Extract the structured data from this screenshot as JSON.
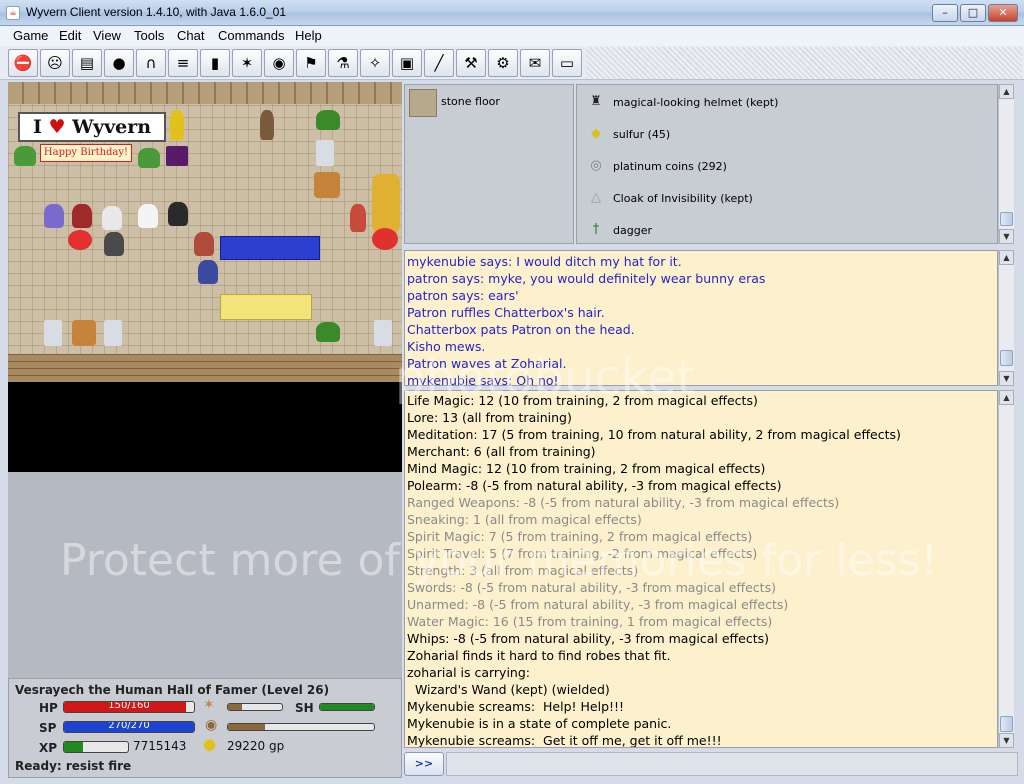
{
  "window": {
    "title": "Wyvern Client version 1.4.10, with Java 1.6.0_01",
    "min_glyph": "–",
    "max_glyph": "□",
    "close_glyph": "✕"
  },
  "menu": [
    "Game",
    "Edit",
    "View",
    "Tools",
    "Chat",
    "Commands",
    "Help"
  ],
  "toolbar": {
    "buttons": [
      {
        "icon": "no-entry-icon",
        "glyph": "⛔"
      },
      {
        "icon": "who-icon",
        "glyph": "☹"
      },
      {
        "icon": "bag-icon",
        "glyph": "▤"
      },
      {
        "icon": "coins-icon",
        "glyph": "●"
      },
      {
        "icon": "doorway-icon",
        "glyph": "∩"
      },
      {
        "icon": "scroll-icon",
        "glyph": "≡"
      },
      {
        "icon": "door-icon",
        "glyph": "▮"
      },
      {
        "icon": "cast-icon",
        "glyph": "✶"
      },
      {
        "icon": "eye-icon",
        "glyph": "◉"
      },
      {
        "icon": "signpost-icon",
        "glyph": "⚑"
      },
      {
        "icon": "potion-icon",
        "glyph": "⚗"
      },
      {
        "icon": "sparkle-icon",
        "glyph": "✧"
      },
      {
        "icon": "lock-icon",
        "glyph": "▣"
      },
      {
        "icon": "wand-icon",
        "glyph": "╱"
      },
      {
        "icon": "tools-icon",
        "glyph": "⚒"
      },
      {
        "icon": "gear-icon",
        "glyph": "⚙"
      },
      {
        "icon": "speech-bubble-icon",
        "glyph": "✉"
      },
      {
        "icon": "chat-bubble-icon",
        "glyph": "▭"
      }
    ]
  },
  "map": {
    "banner_pre": "I",
    "banner_heart": "♥",
    "banner_post": "Wyvern",
    "sign": "Happy Birthday!"
  },
  "floor": {
    "label": "stone floor"
  },
  "inventory": [
    {
      "label": "magical-looking helmet (kept)",
      "icon": "helmet-icon",
      "glyph": "♜",
      "color": "#222222"
    },
    {
      "label": "sulfur (45)",
      "icon": "sulfur-icon",
      "glyph": "◆",
      "color": "#d8c21a"
    },
    {
      "label": "platinum coins (292)",
      "icon": "coins-icon",
      "glyph": "◎",
      "color": "#7a7f88"
    },
    {
      "label": "Cloak of Invisibility (kept)",
      "icon": "cloak-icon",
      "glyph": "△",
      "color": "#9aa0a8"
    },
    {
      "label": "dagger",
      "icon": "dagger-icon",
      "glyph": "†",
      "color": "#3a7a2a"
    }
  ],
  "chat": [
    "mykenubie says: I would ditch my hat for it.",
    "patron says: myke, you would definitely wear bunny eras",
    "patron says: ears'",
    "Patron ruffles Chatterbox's hair.",
    "Chatterbox pats Patron on the head.",
    "Kisho mews.",
    "Patron waves at Zoharial.",
    "mykenubie says: Oh no!"
  ],
  "log": [
    "Life Magic: 12 (10 from training, 2 from magical effects)",
    "Lore: 13 (all from training)",
    "Meditation: 17 (5 from training, 10 from natural ability, 2 from magical effects)",
    "Merchant: 6 (all from training)",
    "Mind Magic: 12 (10 from training, 2 from magical effects)",
    "Polearm: -8 (-5 from natural ability, -3 from magical effects)",
    "Ranged Weapons: -8 (-5 from natural ability, -3 from magical effects)",
    "Sneaking: 1 (all from magical effects)",
    "Spirit Magic: 7 (5 from training, 2 from magical effects)",
    "Spirit Travel: 5 (7 from training, -2 from magical effects)",
    "Strength: 3 (all from magical effects)",
    "Swords: -8 (-5 from natural ability, -3 from magical effects)",
    "Unarmed: -8 (-5 from natural ability, -3 from magical effects)",
    "Water Magic: 16 (15 from training, 1 from magical effects)",
    "Whips: -8 (-5 from natural ability, -3 from magical effects)",
    "Zoharial finds it hard to find robes that fit.",
    "zoharial is carrying:",
    "  Wizard's Wand (kept) (wielded)",
    "Mykenubie screams:  Help! Help!!!",
    "Mykenubie is in a state of complete panic.",
    "Mykenubie screams:  Get it off me, get it off me!!!"
  ],
  "status": {
    "character": "Vesrayech the Human Hall of Famer (Level 26)",
    "hp_label": "HP",
    "hp_text": "150/160",
    "hp_fraction": 0.94,
    "sp_label": "SP",
    "sp_text": "270/270",
    "sp_fraction": 1.0,
    "sh_label": "SH",
    "sh_fraction": 1.0,
    "food_fraction": 0.25,
    "encumbrance_fraction": 0.25,
    "xp_label": "XP",
    "xp_value": "7715143",
    "xp_fraction": 0.3,
    "gold_value": "29220 gp",
    "ready": "Ready:  resist fire"
  },
  "command": {
    "submit_label": ">>"
  },
  "colors": {
    "hp": "#d01818",
    "sp": "#1c44d0",
    "sh": "#1f8a1f",
    "xp": "#1f8a1f",
    "food": "#8a6a3a",
    "chat_text": "#2424c8"
  },
  "watermark": {
    "line1": "Protect more of your memories for less!",
    "line2": "photobucket"
  }
}
